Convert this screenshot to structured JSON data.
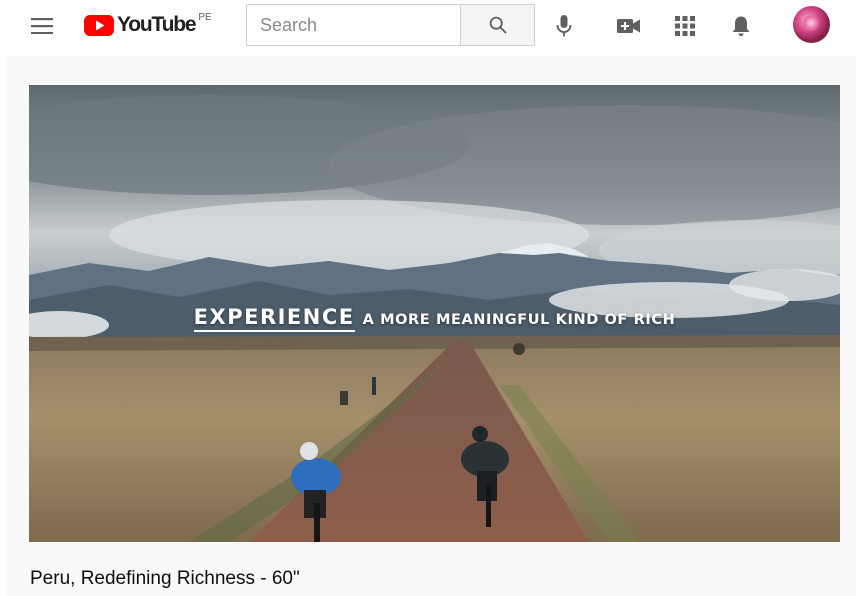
{
  "header": {
    "menu_icon": "hamburger-menu-icon",
    "logo": {
      "wordmark": "YouTube",
      "region": "PE",
      "brand_color": "#ff0000"
    },
    "search": {
      "placeholder": "Search",
      "value": ""
    },
    "icons": [
      "search-icon",
      "microphone-icon",
      "create-video-icon",
      "apps-grid-icon",
      "notifications-bell-icon"
    ],
    "avatar": "user-avatar"
  },
  "ad": {
    "tagline_emphasis": "EXPERIENCE",
    "tagline_rest": "A MORE MEANINGFUL KIND OF RICH",
    "video_title": "Peru, Redefining Richness - 60\""
  }
}
